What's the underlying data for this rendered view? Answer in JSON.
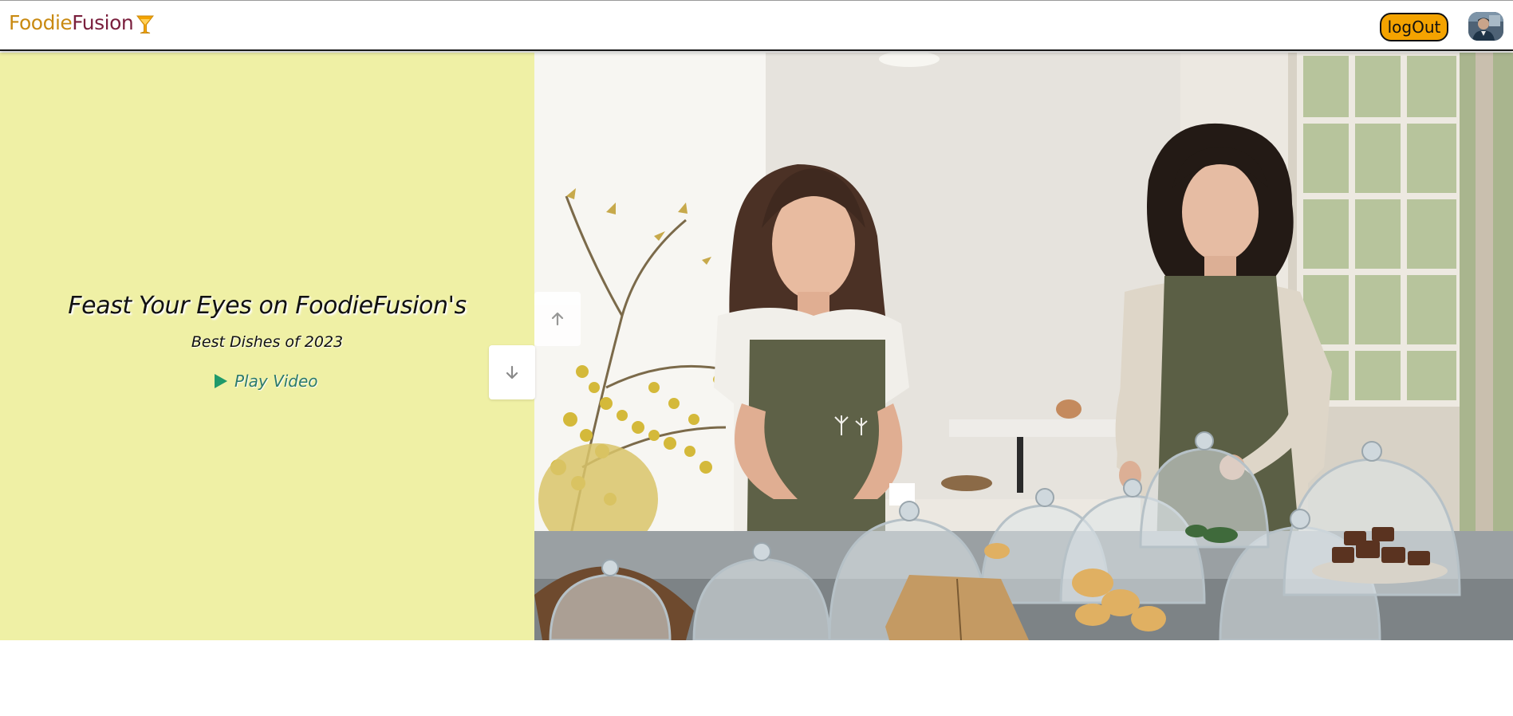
{
  "header": {
    "logo": {
      "part1": "Foodie",
      "part2": "Fusion",
      "icon": "cocktail-glass-icon"
    },
    "logout_label": "logOut",
    "avatar_icon": "user-avatar"
  },
  "hero": {
    "title": "Feast Your Eyes on FoodieFusion's",
    "subtitle": "Best Dishes of 2023",
    "play_label": "Play Video",
    "play_icon": "play-icon",
    "scroll_up_icon": "arrow-up-icon",
    "scroll_down_icon": "arrow-down-icon",
    "photo": "two women in aprons arranging pastries under glass domes"
  },
  "colors": {
    "hero_left_bg": "#eff0a5",
    "logout_bg": "#f4a300",
    "logo_foodie": "#c98a12",
    "logo_fusion": "#7a1f3d",
    "play_accent": "#2c7a6b"
  }
}
